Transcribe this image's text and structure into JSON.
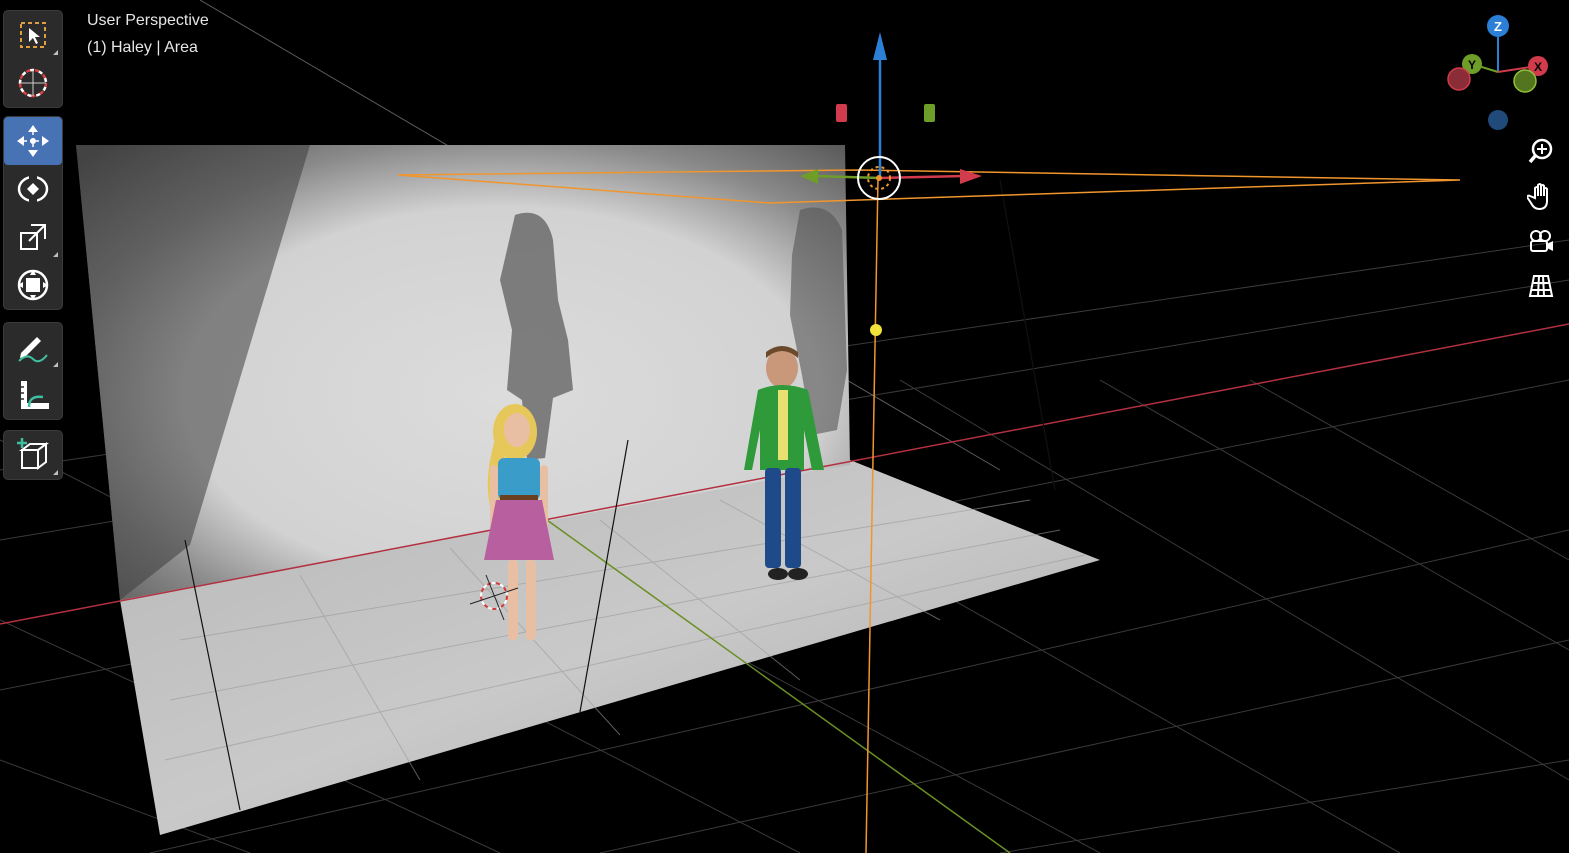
{
  "viewport": {
    "title": "User Perspective",
    "subtitle": "(1) Haley | Area"
  },
  "toolbar": {
    "tools": [
      {
        "name": "select-box",
        "icon": "select-box-icon"
      },
      {
        "name": "cursor",
        "icon": "cursor-icon"
      },
      {
        "name": "move",
        "icon": "move-icon",
        "active": true
      },
      {
        "name": "rotate",
        "icon": "rotate-icon"
      },
      {
        "name": "scale",
        "icon": "scale-icon"
      },
      {
        "name": "transform",
        "icon": "transform-icon"
      },
      {
        "name": "annotate",
        "icon": "annotate-icon"
      },
      {
        "name": "measure",
        "icon": "measure-icon"
      },
      {
        "name": "add-cube",
        "icon": "add-cube-icon"
      }
    ]
  },
  "gizmo": {
    "axes": [
      "Z",
      "Y",
      "X"
    ],
    "colors": {
      "x": "#d13b4b",
      "y": "#6e9e28",
      "z": "#2b7fd6"
    }
  },
  "nav_tools": [
    "zoom-icon",
    "hand-pan-icon",
    "camera-icon",
    "grid-ortho-icon"
  ],
  "colors": {
    "active_tool": "#4772b3",
    "selection": "#f0962d",
    "x_axis": "#d13b4b",
    "y_axis": "#7a9e2a"
  }
}
